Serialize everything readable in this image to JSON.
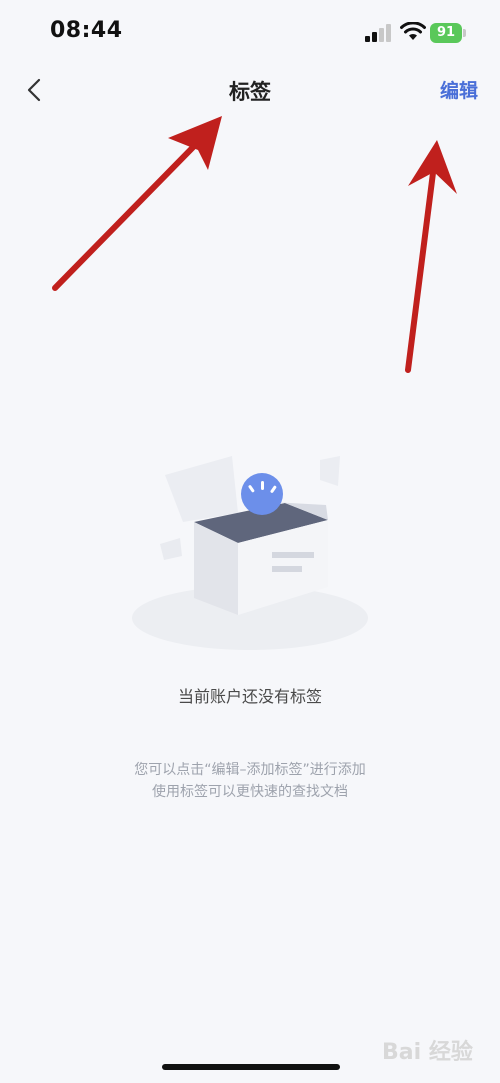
{
  "status_bar": {
    "time": "08:44",
    "battery_level": "91",
    "signal_icon": "cellular-signal-icon",
    "wifi_icon": "wifi-icon",
    "battery_icon": "battery-charging-icon"
  },
  "nav_bar": {
    "back_icon": "chevron-left-icon",
    "title": "标签",
    "edit_label": "编辑"
  },
  "empty_state": {
    "illustration": "empty-box-illustration",
    "message": "当前账户还没有标签",
    "hint_line_1": "您可以点击“编辑–添加标签”进行添加",
    "hint_line_2": "使用标签可以更快速的查找文档"
  },
  "watermark": {
    "text": "Bai 经验"
  },
  "colors": {
    "background": "#f6f7fa",
    "accent": "#4a6fd8",
    "arrow": "#c0201d",
    "battery": "#5ac85a"
  }
}
